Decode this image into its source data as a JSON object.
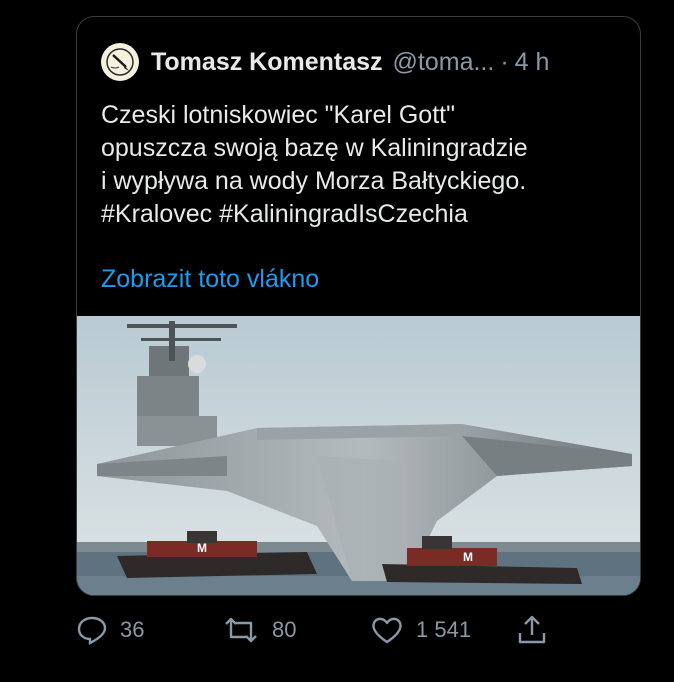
{
  "tweet": {
    "author_name": "Tomasz Komentasz",
    "handle": "@toma...",
    "separator": "·",
    "time": "4 h",
    "lines": [
      "Czeski lotniskowiec \"Karel Gott\"",
      "opuszcza swoją bazę w Kaliningradzie",
      "i wypływa na wody Morza Bałtyckiego.",
      "#Kralovec #KaliningradIsCzechia"
    ],
    "thread_link": "Zobrazit toto vlákno",
    "tug_marking": "M"
  },
  "actions": {
    "replies": "36",
    "retweets": "80",
    "likes": "1 541"
  },
  "icons": [
    "avatar-pen-icon",
    "reply-icon",
    "retweet-icon",
    "like-icon",
    "share-icon"
  ],
  "colors": {
    "accent": "#1d9bf0",
    "muted": "#8b98a5",
    "text": "#e7e9ea",
    "border": "#3a3d40"
  }
}
